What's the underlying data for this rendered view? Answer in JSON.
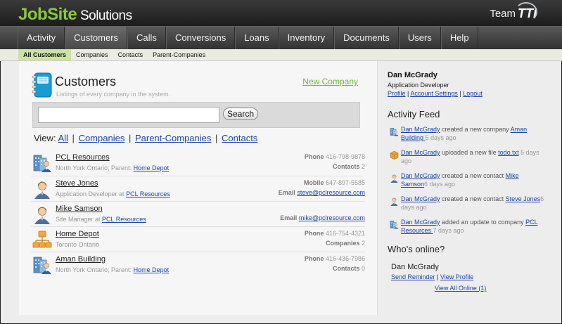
{
  "brand": {
    "part1": "JobSite",
    "part2": " Solutions",
    "team_label": "Team",
    "team_logo": "TTI"
  },
  "nav": [
    {
      "label": "Activity"
    },
    {
      "label": "Customers",
      "active": true
    },
    {
      "label": "Calls"
    },
    {
      "label": "Conversions"
    },
    {
      "label": "Loans"
    },
    {
      "label": "Inventory"
    },
    {
      "label": "Documents"
    },
    {
      "label": "Users"
    },
    {
      "label": "Help"
    }
  ],
  "subnav": [
    {
      "label": "All Customers",
      "active": true
    },
    {
      "label": "Companies"
    },
    {
      "label": "Contacts"
    },
    {
      "label": "Parent-Companies"
    }
  ],
  "page": {
    "title": "Customers",
    "subtitle": "Listings of every company in the system.",
    "new_company": "New Company",
    "search_value": "",
    "search_button": "Search",
    "view_label": "View:",
    "view_links": [
      "All",
      "Companies",
      "Parent-Companies",
      "Contacts"
    ]
  },
  "rows": [
    {
      "type": "company",
      "name": "PCL Resources",
      "sub_prefix": "North York Ontario; Parent: ",
      "sub_link": "Home Depot",
      "r1_label": "Phone",
      "r1_value": "416-798-9878",
      "r2_label": "Contacts",
      "r2_value": "2"
    },
    {
      "type": "person",
      "name": "Steve Jones",
      "sub_prefix": "Application Developer at ",
      "sub_link": "PCL Resources",
      "r1_label": "Mobile",
      "r1_value": "647-897-5585",
      "r2_label": "Email",
      "r2_link": "steve@pclresource.com"
    },
    {
      "type": "person",
      "name": "Mike Samson",
      "sub_prefix": "Site Manager at ",
      "sub_link": "PCL Resources",
      "r1_label": "",
      "r1_value": "",
      "r2_label": "Email",
      "r2_link": "mike@pclresource.com"
    },
    {
      "type": "parent",
      "name": "Home Depot",
      "sub_prefix": "Toronto Ontario",
      "sub_link": "",
      "r1_label": "Phone",
      "r1_value": "416-754-4321",
      "r2_label": "Companies",
      "r2_value": "2"
    },
    {
      "type": "company",
      "name": "Aman Building",
      "sub_prefix": "North York Ontario; Parent: ",
      "sub_link": "Home Depot",
      "r1_label": "Phone",
      "r1_value": "416-436-7986",
      "r2_label": "Contacts",
      "r2_value": "0"
    }
  ],
  "sidebar": {
    "user_name": "Dan McGrady",
    "user_role": "Application Developer",
    "links": [
      "Profile",
      "Account Settings",
      "Logout"
    ],
    "activity_title": "Activity Feed",
    "feed": [
      {
        "icon": "company-icon",
        "user": "Dan McGrady",
        "text": " created a new company ",
        "target": "Aman Building ",
        "time": "5 days ago"
      },
      {
        "icon": "file-icon",
        "user": "Dan McGrady",
        "text": " uploaded a new file ",
        "target": "todo.txt",
        "time": " 5 days ago"
      },
      {
        "icon": "person-icon",
        "user": "Dan McGrady",
        "text": " created a new contact ",
        "target": "Mike Samson",
        "time": "6 days ago"
      },
      {
        "icon": "person-icon",
        "user": "Dan McGrady",
        "text": " created a new contact ",
        "target": "Steve Jones",
        "time": "6 days ago"
      },
      {
        "icon": "company-icon",
        "user": "Dan McGrady",
        "text": " added an update to company ",
        "target": "PCL Resources ",
        "time": "7 days ago"
      }
    ],
    "online_title": "Who's online?",
    "online_user": "Dan McGrady",
    "online_links": [
      "Send Reminder",
      "View Profile"
    ],
    "view_all_online": "View All Online (1)"
  }
}
